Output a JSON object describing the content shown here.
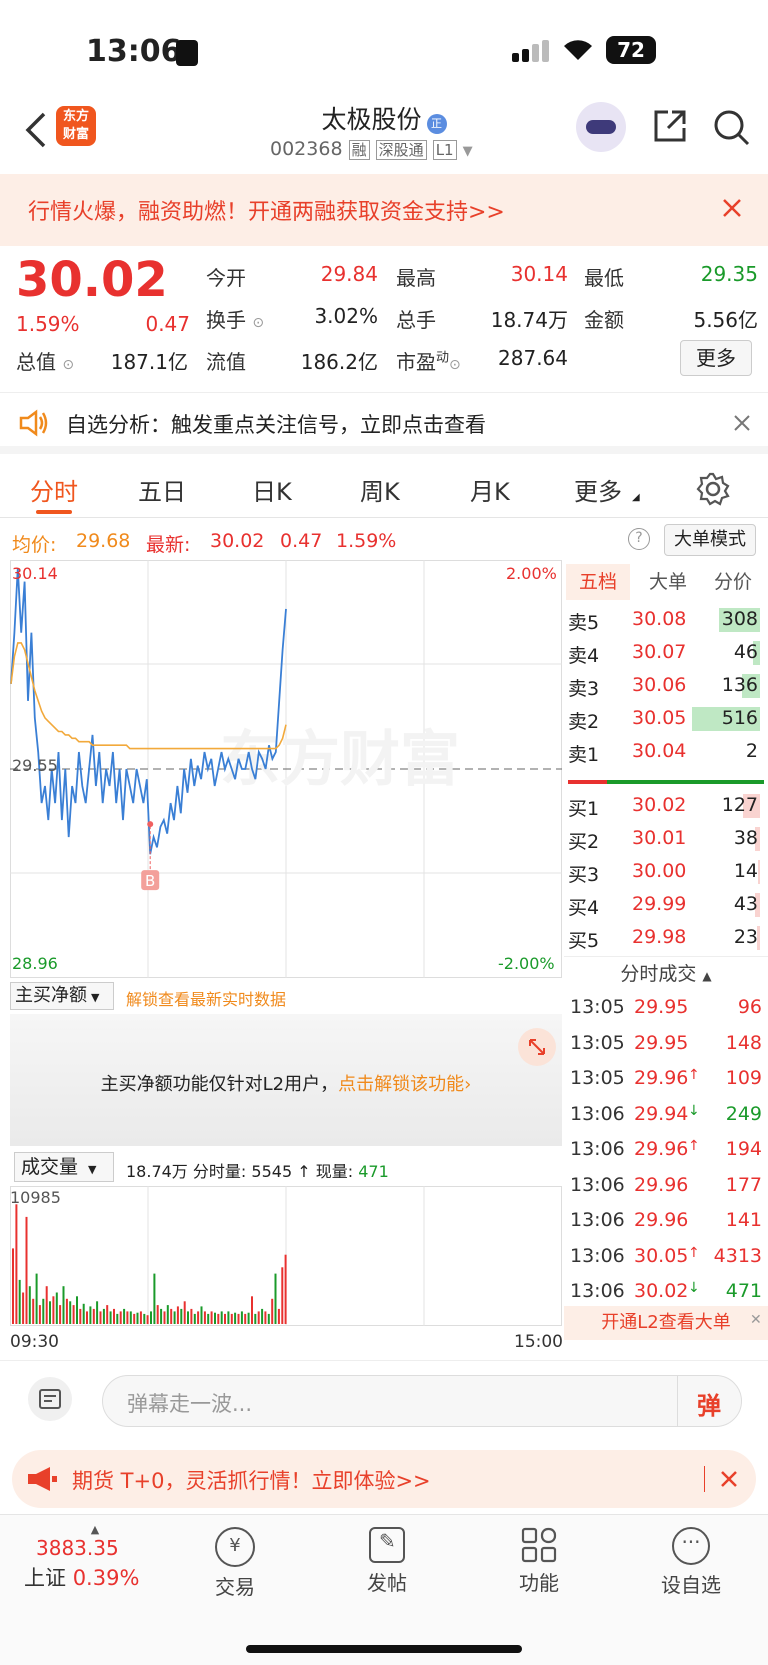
{
  "status_bar": {
    "time": "13:06",
    "battery": "72"
  },
  "header": {
    "logo_line1": "东方",
    "logo_line2": "财富",
    "stock_name": "太极股份",
    "name_badge": "正",
    "stock_code": "002368",
    "tags": [
      "融",
      "深股通",
      "L1"
    ]
  },
  "banner": {
    "text": "行情火爆，融资助燃！开通两融获取资金支持>>"
  },
  "quote": {
    "price": "30.02",
    "change_pct": "1.59%",
    "change": "0.47",
    "today_open_label": "今开",
    "today_open": "29.84",
    "high_label": "最高",
    "high": "30.14",
    "low_label": "最低",
    "low": "29.35",
    "turnover_label": "换手",
    "turnover": "3.02%",
    "volume_label": "总手",
    "volume": "18.74万",
    "amount_label": "金额",
    "amount": "5.56亿",
    "mktcap_label": "总值",
    "mktcap": "187.1亿",
    "float_label": "流值",
    "float": "186.2亿",
    "pe_label": "市盈",
    "pe_sup": "动",
    "pe": "287.64",
    "more_button": "更多"
  },
  "notice": {
    "text": "自选分析：触发重点关注信号，立即点击查看"
  },
  "tabs": [
    "分时",
    "五日",
    "日K",
    "周K",
    "月K",
    "更多"
  ],
  "active_tab": "分时",
  "infoline": {
    "avg_label": "均价:",
    "avg": "29.68",
    "latest_label": "最新:",
    "latest": "30.02",
    "latest_change": "0.47",
    "latest_pct": "1.59%",
    "mode_button": "大单模式"
  },
  "chart_data": {
    "type": "line",
    "y_top": "30.14",
    "y_mid": "29.55",
    "y_bottom": "28.96",
    "pct_top": "2.00%",
    "pct_bottom": "-2.00%",
    "ylim": [
      28.96,
      30.14
    ],
    "series": [
      {
        "name": "price",
        "values": [
          29.8,
          29.95,
          30.14,
          29.95,
          30.1,
          29.75,
          29.95,
          29.7,
          29.6,
          29.45,
          29.5,
          29.4,
          29.55,
          29.45,
          29.6,
          29.4,
          29.55,
          29.35,
          29.5,
          29.45,
          29.6,
          29.5,
          29.45,
          29.55,
          29.65,
          29.5,
          29.6,
          29.45,
          29.55,
          29.5,
          29.6,
          29.45,
          29.55,
          29.4,
          29.55,
          29.5,
          29.45,
          29.55,
          29.5,
          29.45,
          29.52,
          29.3,
          29.35,
          29.32,
          29.38,
          29.4,
          29.36,
          29.45,
          29.4,
          29.5,
          29.42,
          29.55,
          29.48,
          29.58,
          29.5,
          29.56,
          29.52,
          29.6,
          29.55,
          29.58,
          29.5,
          29.55,
          29.6,
          29.55,
          29.58,
          29.55,
          29.52,
          29.58,
          29.55,
          29.55,
          29.6,
          29.55,
          29.52,
          29.6,
          29.58,
          29.55,
          29.62,
          29.58,
          29.6,
          29.75,
          29.9,
          30.02
        ]
      },
      {
        "name": "avg",
        "values": [
          29.8,
          29.88,
          29.92,
          29.92,
          29.9,
          29.86,
          29.82,
          29.78,
          29.75,
          29.72,
          29.7,
          29.69,
          29.68,
          29.67,
          29.66,
          29.66,
          29.65,
          29.65,
          29.64,
          29.64,
          29.63,
          29.63,
          29.63,
          29.63,
          29.62,
          29.62,
          29.62,
          29.62,
          29.62,
          29.62,
          29.62,
          29.62,
          29.62,
          29.62,
          29.62,
          29.61,
          29.61,
          29.61,
          29.61,
          29.61,
          29.61,
          29.61,
          29.61,
          29.61,
          29.61,
          29.61,
          29.61,
          29.61,
          29.61,
          29.61,
          29.61,
          29.61,
          29.61,
          29.61,
          29.61,
          29.61,
          29.61,
          29.61,
          29.61,
          29.61,
          29.61,
          29.61,
          29.61,
          29.61,
          29.61,
          29.61,
          29.61,
          29.61,
          29.61,
          29.61,
          29.61,
          29.61,
          29.61,
          29.61,
          29.61,
          29.61,
          29.61,
          29.61,
          29.61,
          29.62,
          29.64,
          29.68
        ]
      }
    ],
    "marker": "B"
  },
  "order_book": {
    "tabs": [
      "五档",
      "大单",
      "分价"
    ],
    "asks": [
      {
        "label": "卖5",
        "price": "30.08",
        "vol": "308",
        "bar": 0.6
      },
      {
        "label": "卖4",
        "price": "30.07",
        "vol": "46",
        "bar": 0.1
      },
      {
        "label": "卖3",
        "price": "30.06",
        "vol": "136",
        "bar": 0.27
      },
      {
        "label": "卖2",
        "price": "30.05",
        "vol": "516",
        "bar": 1.0
      },
      {
        "label": "卖1",
        "price": "30.04",
        "vol": "2",
        "bar": 0.0
      }
    ],
    "bids": [
      {
        "label": "买1",
        "price": "30.02",
        "vol": "127",
        "bar": 0.25
      },
      {
        "label": "买2",
        "price": "30.01",
        "vol": "38",
        "bar": 0.07
      },
      {
        "label": "买3",
        "price": "30.00",
        "vol": "14",
        "bar": 0.03
      },
      {
        "label": "买4",
        "price": "29.99",
        "vol": "43",
        "bar": 0.08
      },
      {
        "label": "买5",
        "price": "29.98",
        "vol": "23",
        "bar": 0.05
      }
    ],
    "ticks_title": "分时成交",
    "ticks": [
      {
        "time": "13:05",
        "price": "29.95",
        "arrow": "",
        "vol": "96"
      },
      {
        "time": "13:05",
        "price": "29.95",
        "arrow": "",
        "vol": "148"
      },
      {
        "time": "13:05",
        "price": "29.96",
        "arrow": "↑",
        "vol": "109"
      },
      {
        "time": "13:06",
        "price": "29.94",
        "arrow": "↓",
        "vol": "249"
      },
      {
        "time": "13:06",
        "price": "29.96",
        "arrow": "↑",
        "vol": "194"
      },
      {
        "time": "13:06",
        "price": "29.96",
        "arrow": "",
        "vol": "177"
      },
      {
        "time": "13:06",
        "price": "29.96",
        "arrow": "",
        "vol": "141"
      },
      {
        "time": "13:06",
        "price": "30.05",
        "arrow": "↑",
        "vol": "4313"
      },
      {
        "time": "13:06",
        "price": "30.02",
        "arrow": "↓",
        "vol": "471"
      }
    ],
    "l2_link": "开通L2查看大单"
  },
  "main_buy": {
    "select": "主买净额",
    "unlock_link": "解锁查看最新实时数据",
    "message": "主买净额功能仅针对L2用户，",
    "message_link": "点击解锁该功能"
  },
  "volume": {
    "select": "成交量",
    "total": "18.74万",
    "minute_label": "分时量:",
    "minute": "5545",
    "current_label": "现量:",
    "current": "471",
    "max": "10985",
    "bars": [
      0.6,
      0.95,
      0.35,
      0.25,
      0.85,
      0.3,
      0.2,
      0.4,
      0.15,
      0.2,
      0.3,
      0.18,
      0.22,
      0.25,
      0.15,
      0.3,
      0.2,
      0.18,
      0.15,
      0.22,
      0.12,
      0.16,
      0.1,
      0.14,
      0.12,
      0.18,
      0.1,
      0.12,
      0.15,
      0.1,
      0.12,
      0.08,
      0.1,
      0.12,
      0.1,
      0.1,
      0.08,
      0.09,
      0.1,
      0.08,
      0.07,
      0.1,
      0.4,
      0.15,
      0.12,
      0.1,
      0.15,
      0.12,
      0.1,
      0.14,
      0.12,
      0.18,
      0.1,
      0.12,
      0.08,
      0.1,
      0.14,
      0.1,
      0.08,
      0.1,
      0.09,
      0.08,
      0.1,
      0.08,
      0.1,
      0.08,
      0.09,
      0.08,
      0.1,
      0.08,
      0.09,
      0.22,
      0.08,
      0.1,
      0.12,
      0.1,
      0.08,
      0.2,
      0.4,
      0.12,
      0.45,
      0.55
    ],
    "bar_colors": [
      "r",
      "r",
      "g",
      "r",
      "r",
      "g",
      "r",
      "g",
      "r",
      "g",
      "r",
      "g",
      "r",
      "g",
      "r",
      "g",
      "r",
      "g",
      "r",
      "g",
      "r",
      "g",
      "r",
      "g",
      "r",
      "g",
      "r",
      "g",
      "r",
      "g",
      "r",
      "g",
      "r",
      "g",
      "r",
      "g",
      "r",
      "g",
      "r",
      "g",
      "r",
      "g",
      "g",
      "r",
      "g",
      "r",
      "g",
      "r",
      "g",
      "r",
      "g",
      "r",
      "g",
      "r",
      "g",
      "r",
      "g",
      "r",
      "g",
      "r",
      "g",
      "r",
      "g",
      "r",
      "g",
      "r",
      "g",
      "r",
      "g",
      "r",
      "g",
      "r",
      "g",
      "r",
      "g",
      "r",
      "g",
      "r",
      "g",
      "r",
      "r",
      "r"
    ],
    "time_start": "09:30",
    "time_end": "15:00"
  },
  "comment": {
    "placeholder": "弹幕走一波...",
    "button": "弹"
  },
  "promo": {
    "text": "期货 T+0，灵活抓行情！立即体验>>"
  },
  "bottom_nav": {
    "index_value": "3883.35",
    "index_name": "上证",
    "index_pct": "0.39%",
    "items": [
      "交易",
      "发帖",
      "功能",
      "设自选"
    ]
  }
}
